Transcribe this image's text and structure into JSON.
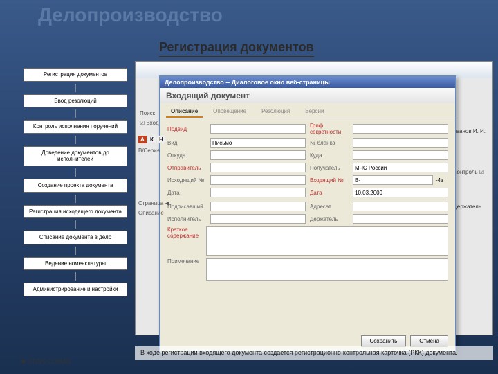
{
  "slide": {
    "title": "Делопроизводство",
    "subtitle": "Регистрация документов"
  },
  "flow": [
    "Регистрация документов",
    "Ввод резолюций",
    "Контроль исполнения поручений",
    "Доведение документов до исполнителей",
    "Создание проекта документа",
    "Регистрация исходящего документа",
    "Списание документа в дело",
    "Ведение номенклатуры",
    "Администрирование и настройки"
  ],
  "bg": {
    "user_label": "Пользователь: Иванов И. И.",
    "controls_label": "Держатель",
    "controls_label2": "Контроль"
  },
  "dialog": {
    "titlebar": "Делопроизводство -- Диалоговое окно веб-страницы",
    "doc_title": "Входящий документ",
    "doc_sub": "",
    "tabs": [
      "Описание",
      "Оповещение",
      "Резолюция",
      "Версии"
    ],
    "fields": {
      "podvid": "Подвид",
      "grif": "Гриф секретности",
      "vid": "Вид",
      "vid_val": "Письмо",
      "blank": "№ бланка",
      "otkuda": "Откуда",
      "kuda": "Куда",
      "otpravitel": "Отправитель",
      "poluchatel": "Получатель",
      "poluchatel_val": "МЧС России",
      "ish_no": "Исходящий №",
      "vh_no": "Входящий №",
      "vh_no_val": "В-",
      "vh_no_suffix": "-4з",
      "data1": "Дата",
      "data2": "Дата",
      "data2_val": "10.03.2009",
      "podpisavshiy": "Подписавший",
      "adresat": "Адресат",
      "ispolnitel": "Исполнитель",
      "derzhatel": "Держатель",
      "opisanie": "Описание",
      "kratkoe": "Краткое содержание",
      "primechanie": "Примечание"
    },
    "buttons": {
      "save": "Сохранить",
      "cancel": "Отмена"
    },
    "search": "Поиск",
    "vhod": "Вход",
    "stranitsa": "Страница"
  },
  "description": "В ходе регистрации входящего документа создается регистрационно-контрольная карточка (РКК) документа.",
  "logo": "STINS COMAN"
}
